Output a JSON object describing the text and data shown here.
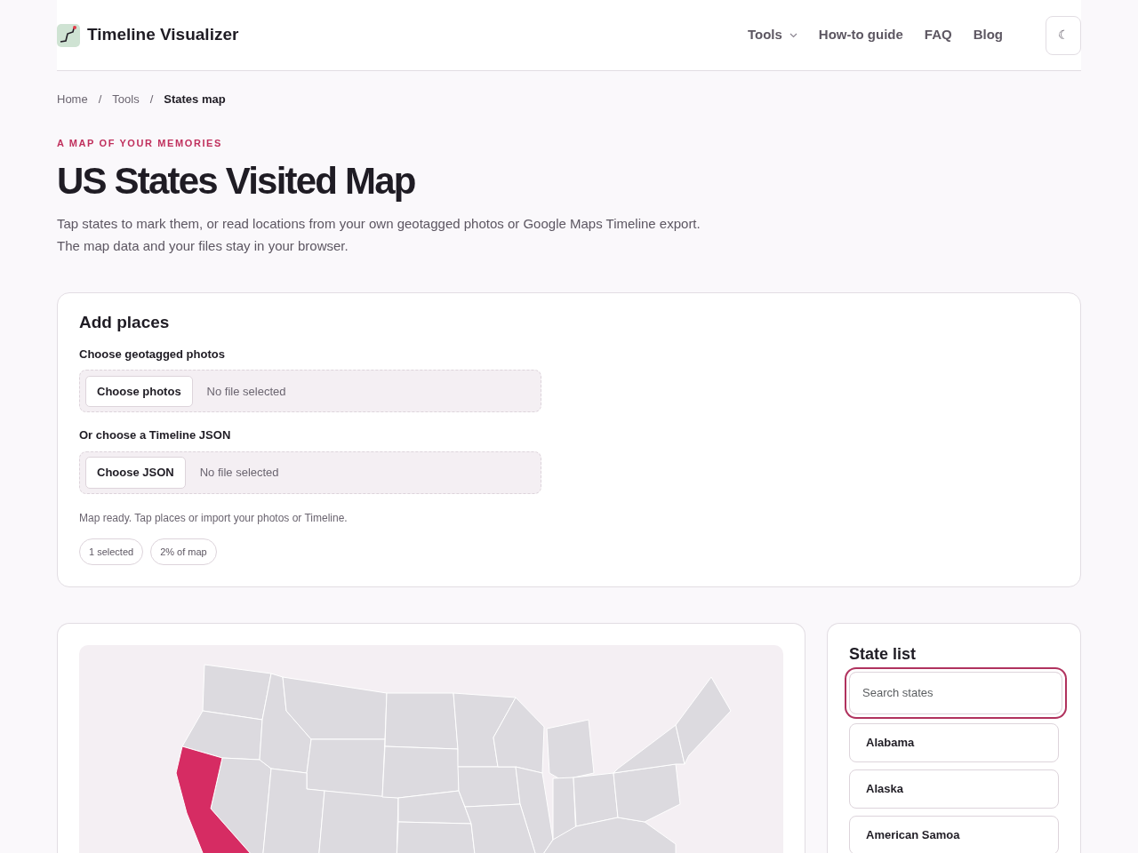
{
  "brand": {
    "name": "Timeline Visualizer"
  },
  "nav": [
    {
      "label": "Tools",
      "kind": "dropdown"
    },
    {
      "label": "How-to guide",
      "kind": "link"
    },
    {
      "label": "FAQ",
      "kind": "link"
    },
    {
      "label": "Blog",
      "kind": "link"
    }
  ],
  "theme_toggle": {
    "glyph": "☾"
  },
  "breadcrumb": [
    {
      "label": "Home",
      "selected": false
    },
    {
      "label": "Tools",
      "selected": false
    },
    {
      "label": "States map",
      "selected": true
    }
  ],
  "breadcrumb_separator": "/",
  "eyebrow": "A MAP OF YOUR MEMORIES",
  "title": "US States Visited Map",
  "intro": "Tap states to mark them, or read locations from your own geotagged photos or Google Maps Timeline export. The map data and your files stay in your browser.",
  "add_places": {
    "heading": "Add places",
    "fields": [
      {
        "label": "Choose geotagged photos",
        "button": "Choose photos",
        "status": "No file selected"
      },
      {
        "label": "Or choose a Timeline JSON",
        "button": "Choose JSON",
        "status": "No file selected"
      }
    ],
    "message": "Map ready. Tap places or import your photos or Timeline.",
    "stats": [
      "1 selected",
      "2% of map"
    ]
  },
  "map": {
    "regions": [
      {
        "selected": false
      },
      {
        "selected": false
      },
      {
        "selected": true
      },
      {
        "selected": false
      },
      {
        "selected": false
      },
      {
        "selected": false
      },
      {
        "selected": false
      },
      {
        "selected": false
      },
      {
        "selected": false
      },
      {
        "selected": false
      },
      {
        "selected": false
      },
      {
        "selected": false
      },
      {
        "selected": false
      },
      {
        "selected": false
      },
      {
        "selected": false
      },
      {
        "selected": false
      },
      {
        "selected": false
      },
      {
        "selected": false
      },
      {
        "selected": false
      },
      {
        "selected": false
      },
      {
        "selected": false
      },
      {
        "selected": false
      },
      {
        "selected": false
      },
      {
        "selected": false
      },
      {
        "selected": false
      }
    ]
  },
  "state_list": {
    "heading": "State list",
    "search": {
      "placeholder": "Search states"
    },
    "states": [
      {
        "name": "Alabama",
        "selected": false
      },
      {
        "name": "Alaska",
        "selected": false
      },
      {
        "name": "American Samoa",
        "selected": false
      }
    ]
  }
}
